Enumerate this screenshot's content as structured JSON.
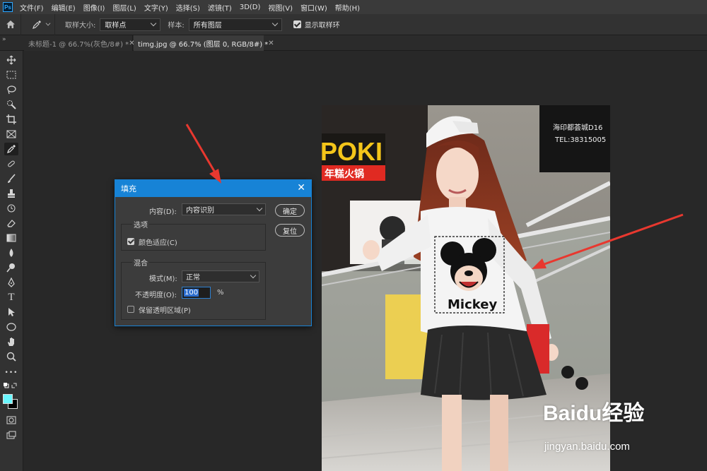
{
  "app": {
    "logo": "Ps"
  },
  "menu": [
    "文件(F)",
    "编辑(E)",
    "图像(I)",
    "图层(L)",
    "文字(Y)",
    "选择(S)",
    "滤镜(T)",
    "3D(D)",
    "视图(V)",
    "窗口(W)",
    "帮助(H)"
  ],
  "options": {
    "sample_size_label": "取样大小:",
    "sample_size_value": "取样点",
    "sample_label": "样本:",
    "sample_value": "所有图层",
    "show_ring_label": "显示取样环",
    "show_ring_checked": true
  },
  "tabs": [
    {
      "title": "未标题-1 @ 66.7%(灰色/8#) *",
      "active": false
    },
    {
      "title": "timg.jpg @ 66.7% (图层 0, RGB/8#) *",
      "active": true
    }
  ],
  "collapse_glyph": "»",
  "toolbar": {
    "foreground_color": "#6af7ff",
    "background_color": "#000000",
    "tools": [
      "move",
      "rect-marquee",
      "lasso",
      "quick-select",
      "crop",
      "frame",
      "eyedropper",
      "healing",
      "brush",
      "stamp",
      "history-brush",
      "eraser",
      "gradient",
      "blur",
      "dodge",
      "pen",
      "type",
      "path-select",
      "ellipse",
      "hand",
      "zoom",
      "more"
    ],
    "active_tool": "eyedropper",
    "type_glyph": "T",
    "more_glyph": "•••"
  },
  "dialog": {
    "title": "填充",
    "close_glyph": "✕",
    "content_label": "内容(D):",
    "content_value": "内容识别",
    "ok_label": "确定",
    "reset_label": "复位",
    "options_group": "选项",
    "color_adapt_label": "颜色适应(C)",
    "color_adapt_checked": true,
    "blend_group": "混合",
    "mode_label": "模式(M):",
    "mode_value": "正常",
    "opacity_label": "不透明度(O):",
    "opacity_value": "100",
    "opacity_unit": "%",
    "preserve_label": "保留透明区域(P)",
    "preserve_checked": false
  },
  "photo": {
    "sign_text": "POKI",
    "sign_sub": "年糕火锅",
    "dark_sign_line1": "海印都荟城D16",
    "dark_sign_line2": "TEL:38315005",
    "shirt_text": "Mickey"
  },
  "watermark": {
    "brand": "Baidu经验",
    "url": "jingyan.baidu.com"
  },
  "colors": {
    "accent": "#1783d6",
    "arrow": "#e8382f"
  }
}
